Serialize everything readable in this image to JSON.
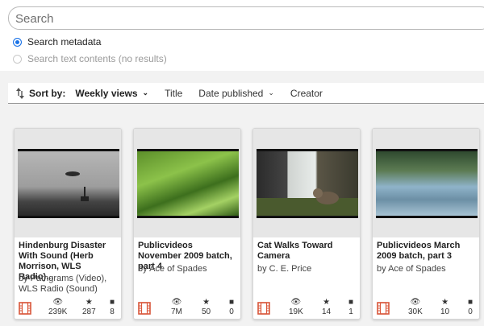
{
  "search": {
    "placeholder": "Search",
    "value": ""
  },
  "search_options": [
    {
      "label": "Search metadata",
      "selected": true
    },
    {
      "label": "Search text contents (no results)",
      "selected": false
    }
  ],
  "sort": {
    "label": "Sort by:",
    "options": [
      {
        "label": "Weekly views",
        "active": true,
        "chevron": true
      },
      {
        "label": "Title",
        "active": false,
        "chevron": false
      },
      {
        "label": "Date published",
        "active": false,
        "chevron": true
      },
      {
        "label": "Creator",
        "active": false,
        "chevron": false
      }
    ]
  },
  "icons": {
    "views": "eye-icon",
    "favorites": "star-icon",
    "reviews": "comment-icon",
    "mediatype": "film-icon"
  },
  "colors": {
    "accent": "#1a73e8",
    "film": "#d9573b"
  },
  "cards": [
    {
      "title": "Hindenburg Disaster With Sound (Herb Morrison, WLS Radio)...",
      "creator": "by Pathgrams (Video), WLS Radio (Sound)",
      "views": "239K",
      "favorites": "287",
      "reviews": "8"
    },
    {
      "title": "Publicvideos November 2009 batch, part 4",
      "creator": "by Ace of Spades",
      "views": "7M",
      "favorites": "50",
      "reviews": "0"
    },
    {
      "title": "Cat Walks Toward Camera",
      "creator": "by C. E. Price",
      "views": "19K",
      "favorites": "14",
      "reviews": "1"
    },
    {
      "title": "Publicvideos March 2009 batch, part 3",
      "creator": "by Ace of Spades",
      "views": "30K",
      "favorites": "10",
      "reviews": "0"
    }
  ]
}
